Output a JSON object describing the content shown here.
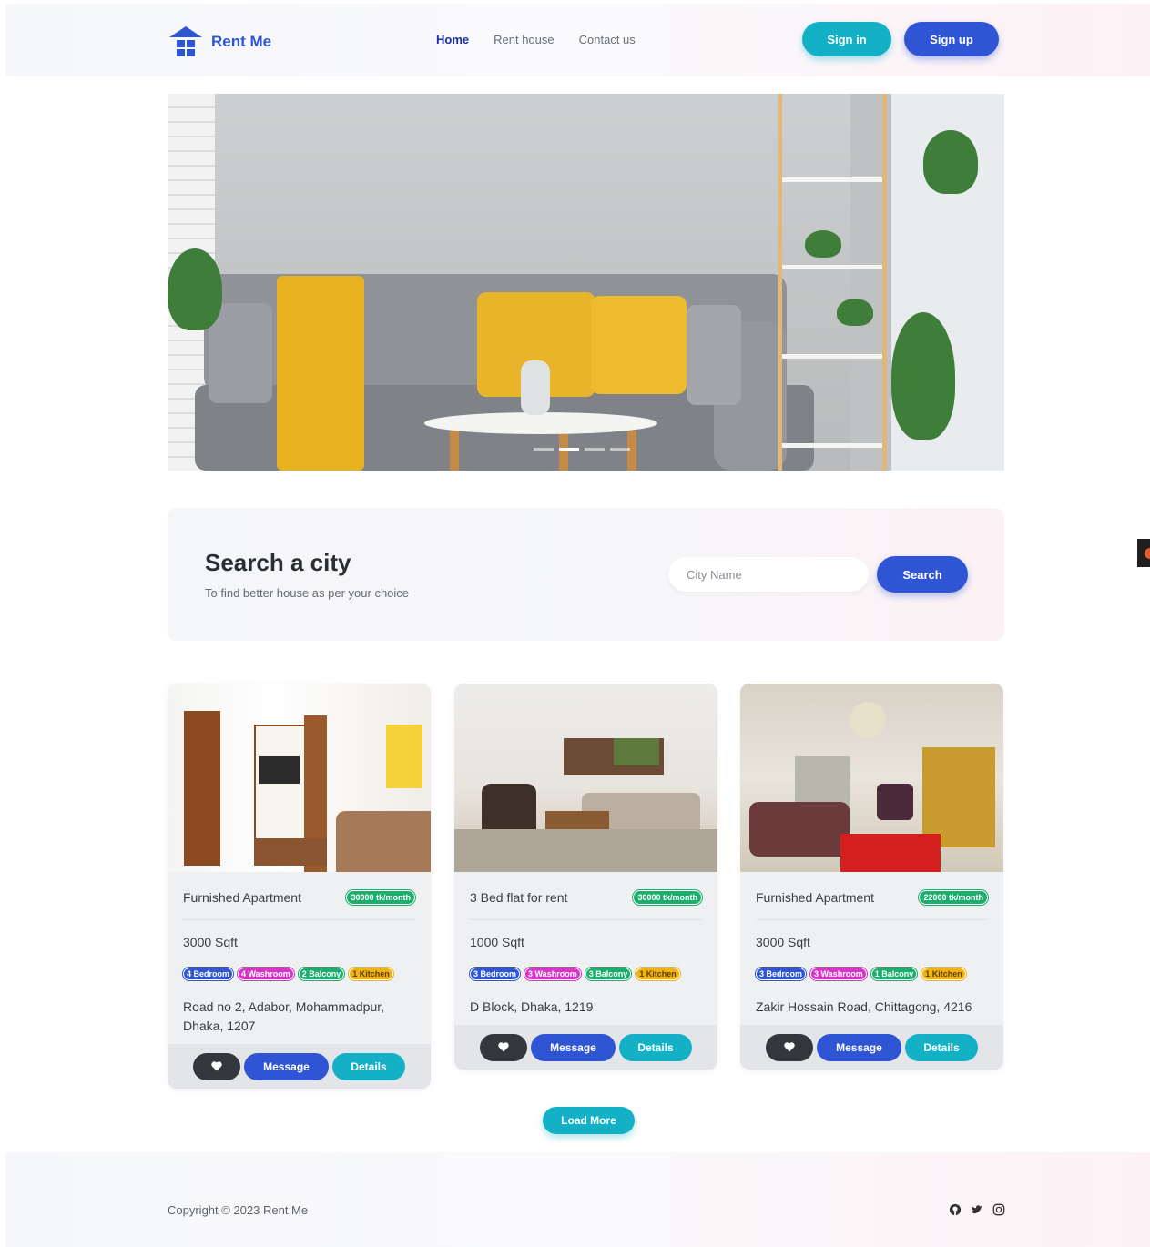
{
  "brand": {
    "name": "Rent Me",
    "color": "#2f55d4"
  },
  "nav": {
    "items": [
      {
        "label": "Home",
        "active": true
      },
      {
        "label": "Rent house",
        "active": false
      },
      {
        "label": "Contact us",
        "active": false
      }
    ]
  },
  "auth": {
    "signin_label": "Sign in",
    "signup_label": "Sign up"
  },
  "hero": {
    "slide_count": 4,
    "active_slide": 2
  },
  "search": {
    "title": "Search a city",
    "subtitle": "To find better house as per your choice",
    "placeholder": "City Name",
    "button_label": "Search"
  },
  "listings": [
    {
      "title": "Furnished Apartment",
      "price": "30000 tk/month",
      "size": "3000 Sqft",
      "tags": {
        "bedroom": "4 Bedroom",
        "washroom": "4 Washroom",
        "balcony": "2 Balcony",
        "kitchen": "1 Kitchen"
      },
      "address": "Road no 2, Adabor, Mohammadpur, Dhaka, 1207"
    },
    {
      "title": "3 Bed flat for rent",
      "price": "30000 tk/month",
      "size": "1000 Sqft",
      "tags": {
        "bedroom": "3 Bedroom",
        "washroom": "3 Washroom",
        "balcony": "3 Balcony",
        "kitchen": "1 Kitchen"
      },
      "address": "D Block, Dhaka, 1219"
    },
    {
      "title": "Furnished Apartment",
      "price": "22000 tk/month",
      "size": "3000 Sqft",
      "tags": {
        "bedroom": "3 Bedroom",
        "washroom": "3 Washroom",
        "balcony": "1 Balcony",
        "kitchen": "1 Kitchen"
      },
      "address": "Zakir Hossain Road, Chittagong, 4216"
    }
  ],
  "card_actions": {
    "message_label": "Message",
    "details_label": "Details",
    "favorite_icon": "heart-icon"
  },
  "load_more_label": "Load More",
  "footer": {
    "copyright": "Copyright © 2023 Rent Me",
    "social_icons": [
      "github-icon",
      "twitter-icon",
      "instagram-icon"
    ]
  },
  "colors": {
    "primary": "#2f55d4",
    "accent": "#14b1c6",
    "dark": "#34373d",
    "green": "#1cae6c",
    "magenta": "#d635c8",
    "yellow": "#f1b314"
  }
}
